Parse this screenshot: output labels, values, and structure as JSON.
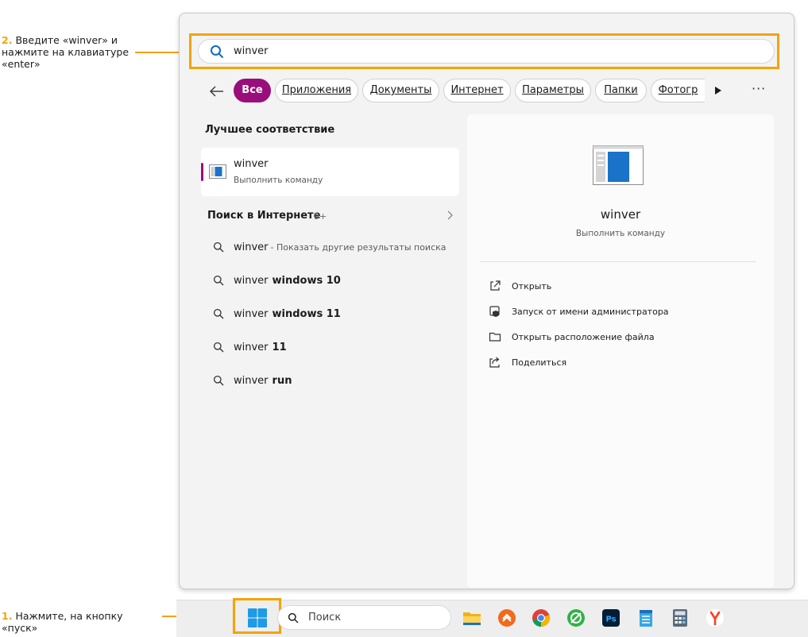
{
  "annotations": {
    "step2": {
      "num": "2.",
      "text_line1": "Введите «winver» и",
      "text_line2": "нажмите на клавиатуре",
      "text_line3": "«enter»"
    },
    "step1": {
      "num": "1.",
      "text": "Нажмите, на кнопку «пуск»"
    }
  },
  "search": {
    "value": "winver"
  },
  "filters": {
    "items": [
      "Все",
      "Приложения",
      "Документы",
      "Интернет",
      "Параметры",
      "Папки",
      "Фотогр"
    ],
    "active_index": 0
  },
  "best_match": {
    "section_title": "Лучшее соответствие",
    "name": "winver",
    "subtitle": "Выполнить команду"
  },
  "web_search": {
    "title": "Поиск в Интернете",
    "count": "9+",
    "suggestions": [
      {
        "base": "winver",
        "bold": "",
        "extra": "- Показать другие результаты поиска"
      },
      {
        "base": "winver",
        "bold": "windows 10",
        "extra": ""
      },
      {
        "base": "winver",
        "bold": "windows 11",
        "extra": ""
      },
      {
        "base": "winver",
        "bold": "11",
        "extra": ""
      },
      {
        "base": "winver",
        "bold": "run",
        "extra": ""
      }
    ]
  },
  "detail": {
    "name": "winver",
    "subtitle": "Выполнить команду",
    "actions": [
      {
        "label": "Открыть",
        "icon": "open-external-icon"
      },
      {
        "label": "Запуск от имени администратора",
        "icon": "shield-admin-icon"
      },
      {
        "label": "Открыть расположение файла",
        "icon": "folder-icon"
      },
      {
        "label": "Поделиться",
        "icon": "share-icon"
      }
    ]
  },
  "taskbar": {
    "search_placeholder": "Поиск",
    "apps": [
      "file-explorer-icon",
      "orange-app-icon",
      "chrome-icon",
      "green-app-icon",
      "photoshop-icon",
      "notepad-icon",
      "calculator-icon",
      "yandex-browser-icon"
    ]
  },
  "colors": {
    "accent": "#9a0e7c",
    "highlight": "#f5a300"
  }
}
